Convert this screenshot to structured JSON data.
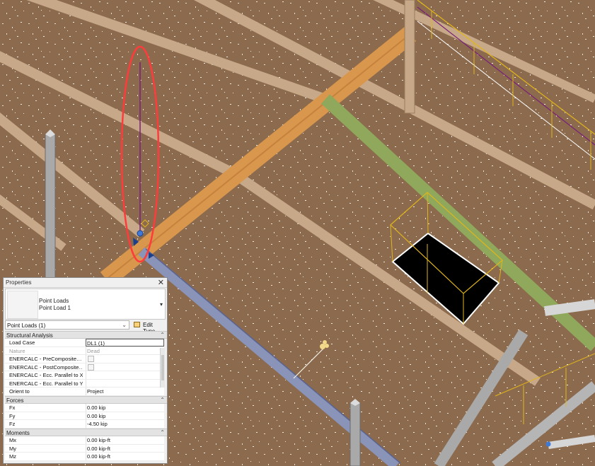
{
  "properties_panel": {
    "title": "Properties",
    "close_label": "✕",
    "type_family": "Point Loads",
    "type_name": "Point Load 1",
    "selector_value": "Point Loads (1)",
    "edit_type_label": "Edit Type",
    "sections": {
      "structural_analysis": {
        "label": "Structural Analysis",
        "rows": [
          {
            "key": "Load Case",
            "value": "DL1 (1)"
          },
          {
            "key": "Nature",
            "value": "Dead"
          },
          {
            "key": "ENERCALC - PreComposite…",
            "value": ""
          },
          {
            "key": "ENERCALC - PostComposite…",
            "value": ""
          },
          {
            "key": "ENERCALC - Ecc. Parallel to XX",
            "value": ""
          },
          {
            "key": "ENERCALC - Ecc. Parallel to YY",
            "value": ""
          },
          {
            "key": "Orient to",
            "value": "Project"
          }
        ]
      },
      "forces": {
        "label": "Forces",
        "rows": [
          {
            "key": "Fx",
            "value": "0.00 kip"
          },
          {
            "key": "Fy",
            "value": "0.00 kip"
          },
          {
            "key": "Fz",
            "value": "-4.50 kip"
          }
        ]
      },
      "moments": {
        "label": "Moments",
        "rows": [
          {
            "key": "Mx",
            "value": "0.00 kip-ft"
          },
          {
            "key": "My",
            "value": "0.00 kip-ft"
          },
          {
            "key": "Mz",
            "value": "0.00 kip-ft"
          }
        ]
      }
    }
  },
  "colors": {
    "floor": "#8b6a4d",
    "beam_light": "#c7a989",
    "beam_selected_orange": "#d9974d",
    "beam_green": "#8fa85c",
    "beam_blue": "#8a93b8",
    "column_gray": "#a9a9a9",
    "highlight_red": "#ff3b3b",
    "load_purple": "#7a1f7a",
    "railing_yellow": "#e0b51c"
  }
}
